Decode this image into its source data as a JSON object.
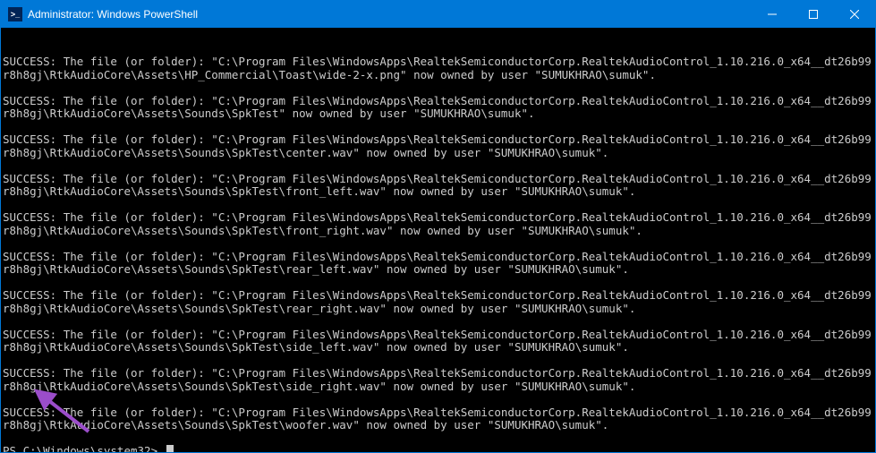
{
  "window": {
    "title": "Administrator: Windows PowerShell",
    "icon_text": ">_"
  },
  "lines": [
    "SUCCESS: The file (or folder): \"C:\\Program Files\\WindowsApps\\RealtekSemiconductorCorp.RealtekAudioControl_1.10.216.0_x64__dt26b99r8h8gj\\RtkAudioCore\\Assets\\HP_Commercial\\Toast\\wide-2-x.png\" now owned by user \"SUMUKHRAO\\sumuk\".",
    "SUCCESS: The file (or folder): \"C:\\Program Files\\WindowsApps\\RealtekSemiconductorCorp.RealtekAudioControl_1.10.216.0_x64__dt26b99r8h8gj\\RtkAudioCore\\Assets\\Sounds\\SpkTest\" now owned by user \"SUMUKHRAO\\sumuk\".",
    "SUCCESS: The file (or folder): \"C:\\Program Files\\WindowsApps\\RealtekSemiconductorCorp.RealtekAudioControl_1.10.216.0_x64__dt26b99r8h8gj\\RtkAudioCore\\Assets\\Sounds\\SpkTest\\center.wav\" now owned by user \"SUMUKHRAO\\sumuk\".",
    "SUCCESS: The file (or folder): \"C:\\Program Files\\WindowsApps\\RealtekSemiconductorCorp.RealtekAudioControl_1.10.216.0_x64__dt26b99r8h8gj\\RtkAudioCore\\Assets\\Sounds\\SpkTest\\front_left.wav\" now owned by user \"SUMUKHRAO\\sumuk\".",
    "SUCCESS: The file (or folder): \"C:\\Program Files\\WindowsApps\\RealtekSemiconductorCorp.RealtekAudioControl_1.10.216.0_x64__dt26b99r8h8gj\\RtkAudioCore\\Assets\\Sounds\\SpkTest\\front_right.wav\" now owned by user \"SUMUKHRAO\\sumuk\".",
    "SUCCESS: The file (or folder): \"C:\\Program Files\\WindowsApps\\RealtekSemiconductorCorp.RealtekAudioControl_1.10.216.0_x64__dt26b99r8h8gj\\RtkAudioCore\\Assets\\Sounds\\SpkTest\\rear_left.wav\" now owned by user \"SUMUKHRAO\\sumuk\".",
    "SUCCESS: The file (or folder): \"C:\\Program Files\\WindowsApps\\RealtekSemiconductorCorp.RealtekAudioControl_1.10.216.0_x64__dt26b99r8h8gj\\RtkAudioCore\\Assets\\Sounds\\SpkTest\\rear_right.wav\" now owned by user \"SUMUKHRAO\\sumuk\".",
    "SUCCESS: The file (or folder): \"C:\\Program Files\\WindowsApps\\RealtekSemiconductorCorp.RealtekAudioControl_1.10.216.0_x64__dt26b99r8h8gj\\RtkAudioCore\\Assets\\Sounds\\SpkTest\\side_left.wav\" now owned by user \"SUMUKHRAO\\sumuk\".",
    "SUCCESS: The file (or folder): \"C:\\Program Files\\WindowsApps\\RealtekSemiconductorCorp.RealtekAudioControl_1.10.216.0_x64__dt26b99r8h8gj\\RtkAudioCore\\Assets\\Sounds\\SpkTest\\side_right.wav\" now owned by user \"SUMUKHRAO\\sumuk\".",
    "SUCCESS: The file (or folder): \"C:\\Program Files\\WindowsApps\\RealtekSemiconductorCorp.RealtekAudioControl_1.10.216.0_x64__dt26b99r8h8gj\\RtkAudioCore\\Assets\\Sounds\\SpkTest\\woofer.wav\" now owned by user \"SUMUKHRAO\\sumuk\"."
  ],
  "prompt": "PS C:\\Windows\\system32> ",
  "annotation": {
    "arrow_color": "#9b4dca"
  }
}
